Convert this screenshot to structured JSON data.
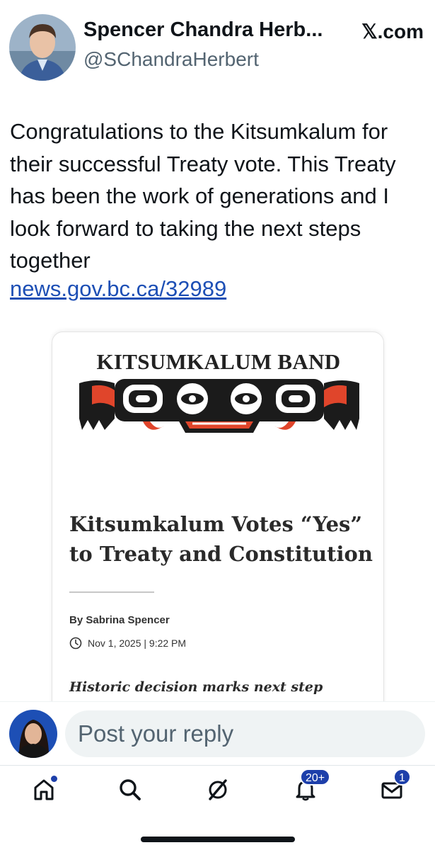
{
  "author": {
    "name": "Spencer Chandra Herb...",
    "handle": "@SChandraHerbert"
  },
  "source": {
    "label": "𝕏.com",
    "icon": "x-logo-icon"
  },
  "post": {
    "text": "Congratulations to the Kitsumkalum for their successful Treaty vote. This Treaty has been the work of generations and I look forward to taking the next steps together",
    "link": "news.gov.bc.ca/32989"
  },
  "card": {
    "band_title": "KITSUMKALUM BAND",
    "article_title": "Kitsumkalum Votes “Yes” to Treaty and Constitution",
    "byline": "By Sabrina Spencer",
    "date": "Nov 1, 2025 | 9:22 PM",
    "subhead": "Historic decision marks next step"
  },
  "reply": {
    "placeholder": "Post your reply"
  },
  "tabbar": {
    "items": [
      {
        "name": "home",
        "icon": "home-icon"
      },
      {
        "name": "search",
        "icon": "search-icon"
      },
      {
        "name": "grok",
        "icon": "grok-icon"
      },
      {
        "name": "notifications",
        "icon": "bell-icon",
        "badge": "20+"
      },
      {
        "name": "messages",
        "icon": "envelope-icon",
        "badge": "1"
      }
    ]
  },
  "colors": {
    "accent": "#1d3faa",
    "link": "#1d4fb5",
    "emblem_red": "#e0452b",
    "emblem_black": "#1b1b1b"
  }
}
